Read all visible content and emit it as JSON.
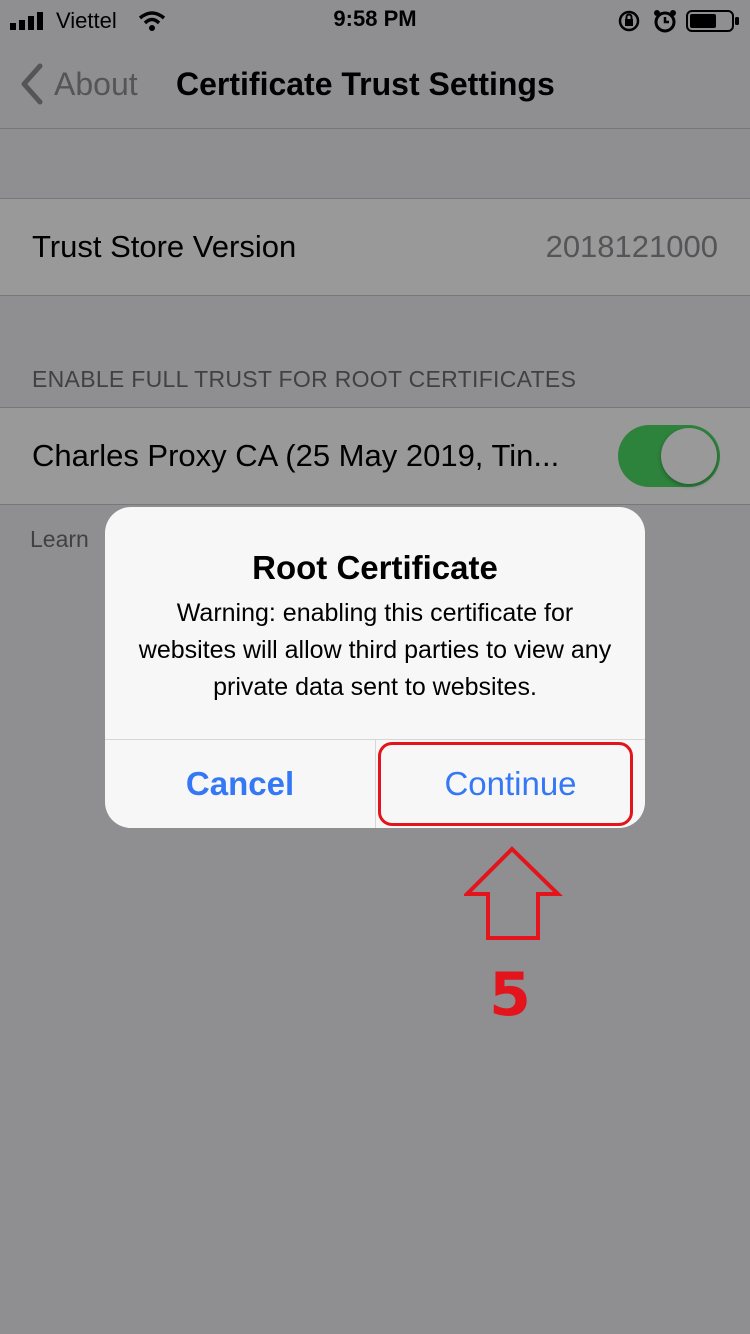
{
  "status_bar": {
    "carrier": "Viettel",
    "time": "9:58 PM",
    "icons": [
      "signal-icon",
      "wifi-icon",
      "rotation-lock-icon",
      "alarm-icon",
      "battery-icon"
    ]
  },
  "nav": {
    "back_label": "About",
    "title": "Certificate Trust Settings"
  },
  "trust_store": {
    "label": "Trust Store Version",
    "value": "2018121000"
  },
  "section_header": "ENABLE FULL TRUST FOR ROOT CERTIFICATES",
  "certificate": {
    "label": "Charles Proxy CA (25 May 2019, Tin...",
    "enabled": true
  },
  "footer_text": "Learn",
  "alert": {
    "title": "Root Certificate",
    "message": "Warning: enabling this certificate for websites will allow third parties to view any private data sent to websites.",
    "cancel_label": "Cancel",
    "continue_label": "Continue"
  },
  "annotation": {
    "step": "5",
    "color": "#e3141b"
  },
  "colors": {
    "accent": "#3478f6",
    "toggle_on": "#4cd964"
  }
}
